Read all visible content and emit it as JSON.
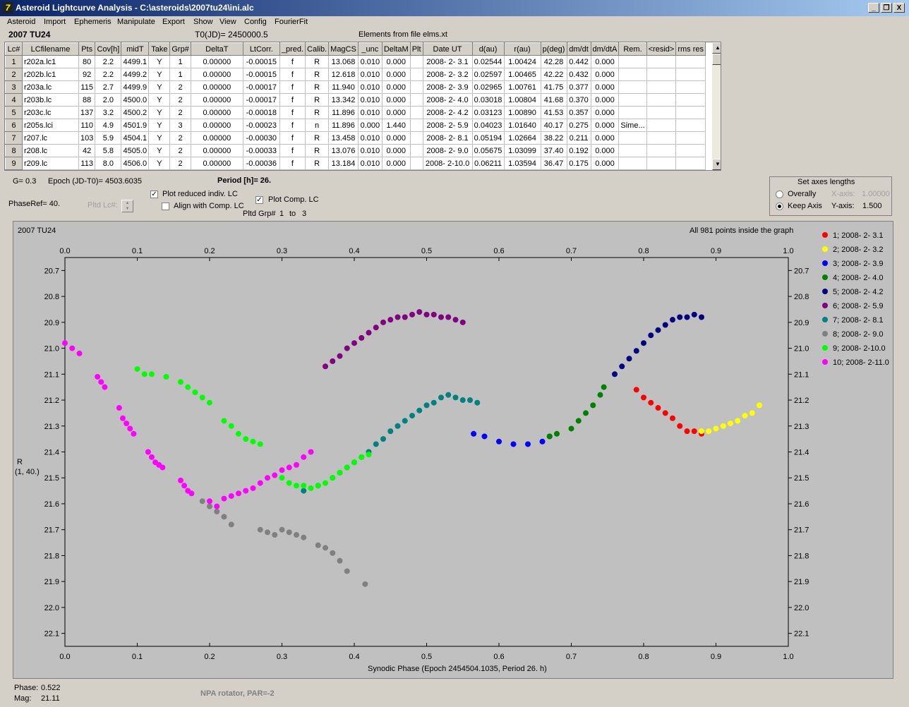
{
  "window": {
    "title": "Asteroid Lightcurve Analysis - C:\\asteroids\\2007tu24\\ini.alc",
    "buttons": {
      "minimize": "_",
      "restore": "❐",
      "close": "X"
    }
  },
  "menu": [
    "Asteroid",
    "Import",
    "Ephemeris",
    "Manipulate",
    "Export",
    "Show",
    "View",
    "Config",
    "FourierFit"
  ],
  "header": {
    "object": "2007 TU24",
    "t0": "T0(JD)= 2450000.5",
    "elements": "Elements from file elms.xt"
  },
  "table": {
    "columns": [
      "Lc#",
      "LCfilename",
      "Pts",
      "Cov[h]",
      "midT",
      "Take",
      "Grp#",
      "DeltaT",
      "LtCorr.",
      "_pred.",
      "Calib.",
      "MagCS",
      "_unc",
      "DeltaM",
      "Plt",
      "Date UT",
      "d(au)",
      "r(au)",
      "p(deg)",
      "dm/dt",
      "dm/dtA",
      "Rem.",
      "<resid>",
      "rms res"
    ],
    "rows": [
      [
        "1",
        "r202a.lc1",
        "80",
        "2.2",
        "4499.1",
        "Y",
        "1",
        "0.00000",
        "-0.00015",
        "f",
        "R",
        "13.068",
        "0.010",
        "0.000",
        "",
        "2008- 2- 3.1",
        "0.02544",
        "1.00424",
        "42.28",
        "0.442",
        "0.000",
        "",
        "",
        ""
      ],
      [
        "2",
        "r202b.lc1",
        "92",
        "2.2",
        "4499.2",
        "Y",
        "1",
        "0.00000",
        "-0.00015",
        "f",
        "R",
        "12.618",
        "0.010",
        "0.000",
        "",
        "2008- 2- 3.2",
        "0.02597",
        "1.00465",
        "42.22",
        "0.432",
        "0.000",
        "",
        "",
        ""
      ],
      [
        "3",
        "r203a.lc",
        "115",
        "2.7",
        "4499.9",
        "Y",
        "2",
        "0.00000",
        "-0.00017",
        "f",
        "R",
        "11.940",
        "0.010",
        "0.000",
        "",
        "2008- 2- 3.9",
        "0.02965",
        "1.00761",
        "41.75",
        "0.377",
        "0.000",
        "",
        "",
        ""
      ],
      [
        "4",
        "r203b.lc",
        "88",
        "2.0",
        "4500.0",
        "Y",
        "2",
        "0.00000",
        "-0.00017",
        "f",
        "R",
        "13.342",
        "0.010",
        "0.000",
        "",
        "2008- 2- 4.0",
        "0.03018",
        "1.00804",
        "41.68",
        "0.370",
        "0.000",
        "",
        "",
        ""
      ],
      [
        "5",
        "r203c.lc",
        "137",
        "3.2",
        "4500.2",
        "Y",
        "2",
        "0.00000",
        "-0.00018",
        "f",
        "R",
        "11.896",
        "0.010",
        "0.000",
        "",
        "2008- 2- 4.2",
        "0.03123",
        "1.00890",
        "41.53",
        "0.357",
        "0.000",
        "",
        "",
        ""
      ],
      [
        "6",
        "r205s.lci",
        "110",
        "4.9",
        "4501.9",
        "Y",
        "3",
        "0.00000",
        "-0.00023",
        "f",
        "n",
        "11.896",
        "0.000",
        "1.440",
        "",
        "2008- 2- 5.9",
        "0.04023",
        "1.01640",
        "40.17",
        "0.275",
        "0.000",
        "Sime...",
        "",
        ""
      ],
      [
        "7",
        "r207.lc",
        "103",
        "5.9",
        "4504.1",
        "Y",
        "2",
        "0.00000",
        "-0.00030",
        "f",
        "R",
        "13.458",
        "0.010",
        "0.000",
        "",
        "2008- 2- 8.1",
        "0.05194",
        "1.02664",
        "38.22",
        "0.211",
        "0.000",
        "",
        "",
        ""
      ],
      [
        "8",
        "r208.lc",
        "42",
        "5.8",
        "4505.0",
        "Y",
        "2",
        "0.00000",
        "-0.00033",
        "f",
        "R",
        "13.076",
        "0.010",
        "0.000",
        "",
        "2008- 2- 9.0",
        "0.05675",
        "1.03099",
        "37.40",
        "0.192",
        "0.000",
        "",
        "",
        ""
      ],
      [
        "9",
        "r209.lc",
        "113",
        "8.0",
        "4506.0",
        "Y",
        "2",
        "0.00000",
        "-0.00036",
        "f",
        "R",
        "13.184",
        "0.010",
        "0.000",
        "",
        "2008- 2-10.0",
        "0.06211",
        "1.03594",
        "36.47",
        "0.175",
        "0.000",
        "",
        "",
        ""
      ]
    ]
  },
  "controls": {
    "g": "G= 0.3",
    "epoch": "Epoch (JD-T0)= 4503.6035",
    "period": "Period [h]= 26.",
    "phase_ref": "PhaseRef= 40.",
    "pltd_lc": "Pltd Lc#:",
    "plot_reduced": "Plot reduced indiv. LC",
    "align_comp": "Align with Comp. LC",
    "plot_comp": "Plot Comp. LC",
    "pltd_grp": "Pltd Grp#",
    "grp_from": "1",
    "grp_to_label": "to",
    "grp_to": "3",
    "plot_reduced_checked": true,
    "align_comp_checked": false,
    "plot_comp_checked": true
  },
  "axes_box": {
    "title": "Set axes lengths",
    "overall": "Overally",
    "keep": "Keep Axis",
    "xaxis_label": "X-axis:",
    "xaxis_value": "1.00000",
    "yaxis_label": "Y-axis:",
    "yaxis_value": "1.500",
    "selected": "keep"
  },
  "status": {
    "phase_label": "Phase:",
    "phase": "0.522",
    "mag_label": "Mag:",
    "mag": "21.11",
    "note": "NPA rotator, PAR=-2"
  },
  "chart_data": {
    "type": "scatter",
    "title": "2007 TU24",
    "note": "All 981 points inside the graph",
    "xlabel": "Synodic Phase (Epoch 2454504.1035, Period 26. h)",
    "ylabel_line1": "R",
    "ylabel_line2": "(1, 40.)",
    "xlim": [
      0.0,
      1.0
    ],
    "ylim": [
      22.15,
      20.65
    ],
    "y_reversed": true,
    "xticks": [
      "0.0",
      "0.1",
      "0.2",
      "0.3",
      "0.4",
      "0.5",
      "0.6",
      "0.7",
      "0.8",
      "0.9",
      "1.0"
    ],
    "yticks": [
      "20.7",
      "20.8",
      "20.9",
      "21.0",
      "21.1",
      "21.2",
      "21.3",
      "21.4",
      "21.5",
      "21.6",
      "21.7",
      "21.8",
      "21.9",
      "22.0",
      "22.1"
    ],
    "series": [
      {
        "name": "1; 2008- 2- 3.1",
        "color": "#ff0000",
        "x": [
          0.79,
          0.8,
          0.81,
          0.82,
          0.83,
          0.84,
          0.85,
          0.86,
          0.87,
          0.88
        ],
        "y": [
          21.16,
          21.19,
          21.21,
          21.23,
          21.25,
          21.27,
          21.3,
          21.32,
          21.32,
          21.33
        ]
      },
      {
        "name": "2; 2008- 2- 3.2",
        "color": "#ffff00",
        "x": [
          0.88,
          0.89,
          0.9,
          0.91,
          0.92,
          0.93,
          0.94,
          0.95,
          0.96
        ],
        "y": [
          21.32,
          21.32,
          21.31,
          21.3,
          21.29,
          21.28,
          21.26,
          21.25,
          21.22
        ]
      },
      {
        "name": "3; 2008- 2- 3.9",
        "color": "#0000ff",
        "x": [
          0.565,
          0.58,
          0.6,
          0.62,
          0.64,
          0.66,
          0.67
        ],
        "y": [
          21.33,
          21.34,
          21.36,
          21.37,
          21.37,
          21.36,
          21.34
        ]
      },
      {
        "name": "4; 2008- 2- 4.0",
        "color": "#008000",
        "x": [
          0.67,
          0.68,
          0.7,
          0.71,
          0.72,
          0.73,
          0.74,
          0.745
        ],
        "y": [
          21.34,
          21.33,
          21.31,
          21.28,
          21.25,
          21.22,
          21.18,
          21.15
        ]
      },
      {
        "name": "5; 2008- 2- 4.2",
        "color": "#000080",
        "x": [
          0.76,
          0.77,
          0.78,
          0.79,
          0.8,
          0.81,
          0.82,
          0.83,
          0.84,
          0.85,
          0.86,
          0.87,
          0.88
        ],
        "y": [
          21.1,
          21.07,
          21.04,
          21.01,
          20.98,
          20.95,
          20.93,
          20.91,
          20.89,
          20.88,
          20.88,
          20.87,
          20.88
        ]
      },
      {
        "name": "6; 2008- 2- 5.9",
        "color": "#800080",
        "x": [
          0.36,
          0.37,
          0.38,
          0.39,
          0.4,
          0.41,
          0.42,
          0.43,
          0.44,
          0.45,
          0.46,
          0.47,
          0.48,
          0.49,
          0.5,
          0.51,
          0.52,
          0.53,
          0.54,
          0.55
        ],
        "y": [
          21.07,
          21.05,
          21.03,
          21.0,
          20.98,
          20.96,
          20.94,
          20.92,
          20.9,
          20.89,
          20.88,
          20.88,
          20.87,
          20.86,
          20.87,
          20.87,
          20.88,
          20.88,
          20.89,
          20.9
        ]
      },
      {
        "name": "7; 2008- 2- 8.1",
        "color": "#008080",
        "x": [
          0.33,
          0.35,
          0.37,
          0.38,
          0.39,
          0.4,
          0.41,
          0.42,
          0.43,
          0.44,
          0.45,
          0.46,
          0.47,
          0.48,
          0.49,
          0.5,
          0.51,
          0.52,
          0.53,
          0.54,
          0.55,
          0.56,
          0.57
        ],
        "y": [
          21.55,
          21.53,
          21.5,
          21.48,
          21.46,
          21.44,
          21.42,
          21.4,
          21.37,
          21.35,
          21.32,
          21.3,
          21.28,
          21.26,
          21.24,
          21.22,
          21.21,
          21.19,
          21.18,
          21.19,
          21.2,
          21.2,
          21.21
        ]
      },
      {
        "name": "8; 2008- 2- 9.0",
        "color": "#808080",
        "x": [
          0.19,
          0.2,
          0.21,
          0.22,
          0.23,
          0.27,
          0.28,
          0.29,
          0.3,
          0.31,
          0.32,
          0.33,
          0.35,
          0.36,
          0.37,
          0.38,
          0.39,
          0.415
        ],
        "y": [
          21.59,
          21.61,
          21.63,
          21.65,
          21.68,
          21.7,
          21.71,
          21.72,
          21.7,
          21.71,
          21.72,
          21.73,
          21.76,
          21.77,
          21.79,
          21.82,
          21.86,
          21.91
        ]
      },
      {
        "name": "9; 2008- 2-10.0",
        "color": "#00ff00",
        "x": [
          0.1,
          0.11,
          0.12,
          0.14,
          0.16,
          0.17,
          0.18,
          0.19,
          0.2,
          0.22,
          0.23,
          0.24,
          0.25,
          0.26,
          0.27,
          0.3,
          0.31,
          0.32,
          0.33,
          0.34,
          0.35,
          0.36,
          0.37,
          0.38,
          0.39,
          0.4,
          0.41,
          0.42
        ],
        "y": [
          21.08,
          21.1,
          21.1,
          21.11,
          21.13,
          21.15,
          21.17,
          21.19,
          21.21,
          21.28,
          21.3,
          21.33,
          21.35,
          21.36,
          21.37,
          21.5,
          21.52,
          21.53,
          21.53,
          21.54,
          21.53,
          21.52,
          21.5,
          21.48,
          21.46,
          21.44,
          21.42,
          21.41
        ]
      },
      {
        "name": "10; 2008- 2-11.0",
        "color": "#ff00ff",
        "x": [
          0.0,
          0.01,
          0.02,
          0.045,
          0.05,
          0.055,
          0.075,
          0.08,
          0.085,
          0.09,
          0.095,
          0.115,
          0.12,
          0.125,
          0.13,
          0.135,
          0.16,
          0.165,
          0.17,
          0.175,
          0.2,
          0.21,
          0.22,
          0.23,
          0.24,
          0.25,
          0.26,
          0.27,
          0.28,
          0.29,
          0.3,
          0.31,
          0.32,
          0.33,
          0.34
        ],
        "y": [
          20.98,
          21.0,
          21.02,
          21.11,
          21.13,
          21.15,
          21.23,
          21.27,
          21.29,
          21.31,
          21.33,
          21.4,
          21.42,
          21.44,
          21.45,
          21.46,
          21.51,
          21.53,
          21.55,
          21.56,
          21.59,
          21.61,
          21.58,
          21.57,
          21.56,
          21.55,
          21.54,
          21.52,
          21.5,
          21.49,
          21.47,
          21.46,
          21.45,
          21.42,
          21.4
        ]
      }
    ]
  }
}
